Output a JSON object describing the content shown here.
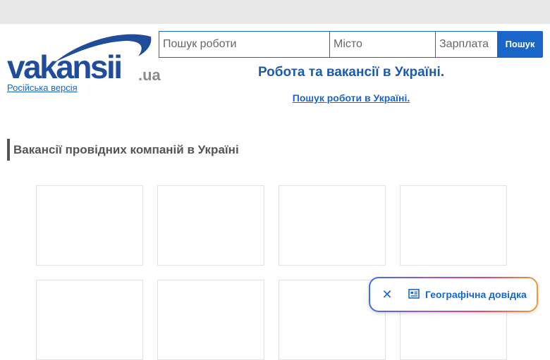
{
  "logo": {
    "word": "vakansii",
    "tld": ".ua",
    "brand_color": "#1f4d9b"
  },
  "header": {
    "lang_link": "Російська версія",
    "headline": "Робота та вакансії в Україні.",
    "sub_link": "Пошук роботи в Україні."
  },
  "search": {
    "job_placeholder": "Пошук роботи",
    "city_placeholder": "Місто",
    "salary_placeholder": "Зарплата",
    "button_label": "Пошук",
    "accent": "#1a66c8"
  },
  "section": {
    "title": "Вакансії провідних компаній в Україні"
  },
  "geo_pill": {
    "label": "Географічна довідка",
    "close_icon": "close-icon",
    "icon": "newspaper-icon"
  }
}
